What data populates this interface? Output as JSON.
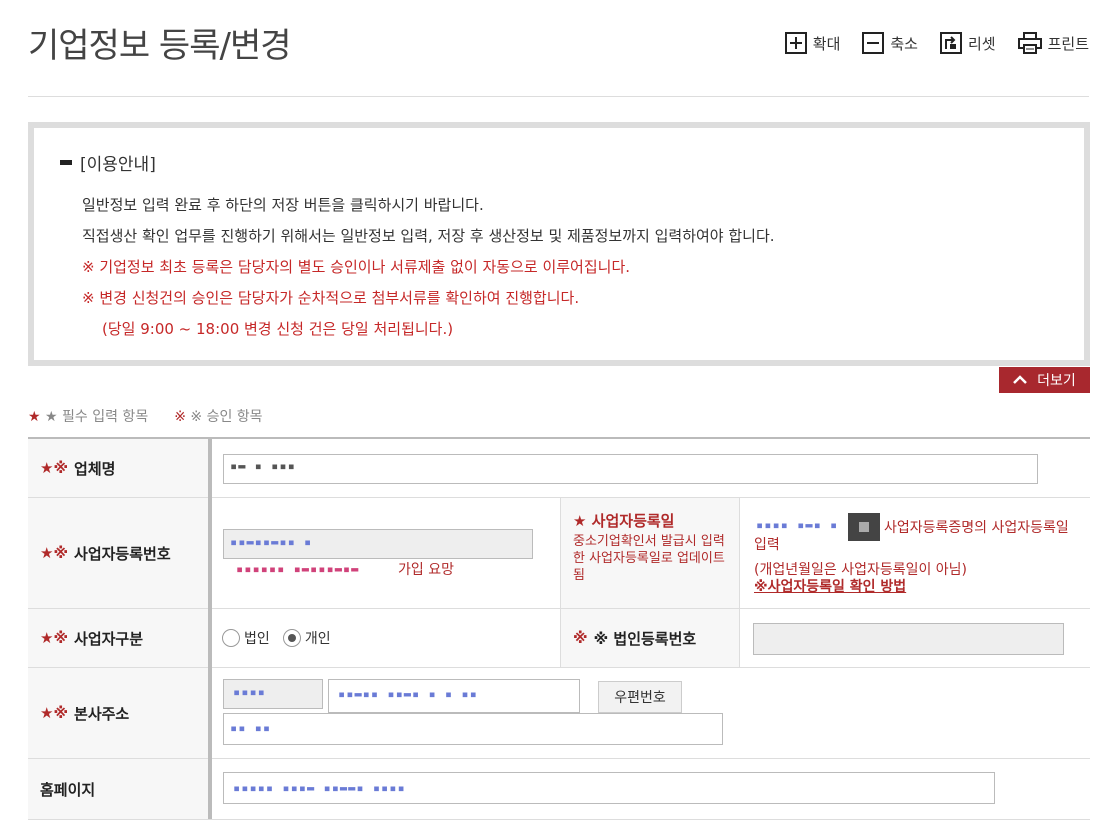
{
  "header": {
    "title": "기업정보 등록/변경",
    "tools": [
      {
        "label": "확대",
        "icon": "zoom-in-icon"
      },
      {
        "label": "축소",
        "icon": "zoom-out-icon"
      },
      {
        "label": "리셋",
        "icon": "reset-icon"
      },
      {
        "label": "프린트",
        "icon": "print-icon"
      }
    ]
  },
  "notice": {
    "title": "[이용안내]",
    "lines": [
      "일반정보 입력 완료 후 하단의 저장 버튼을 클릭하시기 바랍니다.",
      "직접생산 확인 업무를 진행하기 위해서는 일반정보 입력, 저장 후 생산정보 및 제품정보까지 입력하여야 합니다.",
      "※ 기업정보 최초 등록은 담당자의 별도 승인이나 서류제출 없이 자동으로 이루어집니다.",
      "※ 변경 신청건의 승인은 담당자가 순차적으로 첨부서류를 확인하여 진행합니다.",
      "(당일 9:00 ~ 18:00 변경 신청 건은 당일 처리됩니다.)"
    ],
    "more_label": "더보기"
  },
  "legend": {
    "required": "★ 필수 입력 항목",
    "approval": "※ 승인 항목"
  },
  "form": {
    "company_name": {
      "label": "업체명",
      "req": "★※"
    },
    "biz_no": {
      "label": "사업자등록번호",
      "req": "★※",
      "note_tail": "가입 요망"
    },
    "biz_date": {
      "label": "★ 사업자등록일",
      "desc": "중소기업확인서 발급시 입력한 사업자등록일로 업데이트 됨",
      "note1": "사업자등록증명의 사업자등록일 입력",
      "note2": "(개업년월일은 사업자등록일이 아님)",
      "link": "※사업자등록일 확인 방법"
    },
    "biz_type": {
      "label": "사업자구분",
      "req": "★※",
      "options": [
        "법인",
        "개인"
      ],
      "selected": "개인"
    },
    "corp_no": {
      "label": "※ 법인등록번호"
    },
    "address": {
      "label": "본사주소",
      "req": "★※",
      "zip_button": "우편번호"
    },
    "homepage": {
      "label": "홈페이지"
    }
  },
  "colors": {
    "accent": "#a8282e",
    "required": "#b02a2a"
  }
}
